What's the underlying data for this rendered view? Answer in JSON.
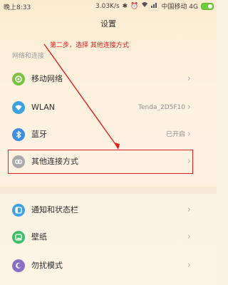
{
  "status_bar": {
    "time": "晚上8:33",
    "speed": "3.03K/s",
    "carrier": "中国移动 4G",
    "icons": [
      "bluetooth-icon",
      "alarm-icon",
      "wifi-icon",
      "signal-icon",
      "battery-icon"
    ]
  },
  "header": {
    "title": "设置"
  },
  "section": {
    "label": "网络和连接"
  },
  "annotation": {
    "text": "第二步，选择 其他连接方式"
  },
  "rows": [
    {
      "label": "移动网络",
      "value": "",
      "icon": "mobile-network-icon",
      "icon_color": "#7cc242"
    },
    {
      "label": "WLAN",
      "value": "Tenda_2D5F10",
      "icon": "wifi-icon",
      "icon_color": "#3fa1e0"
    },
    {
      "label": "蓝牙",
      "value": "已开启",
      "icon": "bluetooth-icon",
      "icon_color": "#3f8de0"
    },
    {
      "label": "其他连接方式",
      "value": "",
      "icon": "link-icon",
      "icon_color": "#a9a9a9"
    },
    {
      "label": "通知和状态栏",
      "value": "",
      "icon": "notification-icon",
      "icon_color": "#3fa1e0"
    },
    {
      "label": "壁纸",
      "value": "",
      "icon": "wallpaper-icon",
      "icon_color": "#3fbf6a"
    },
    {
      "label": "勿扰模式",
      "value": "",
      "icon": "moon-icon",
      "icon_color": "#8c6fc4"
    }
  ],
  "colors": {
    "annotation_red": "#e02020",
    "background": "#fdf3e2"
  }
}
